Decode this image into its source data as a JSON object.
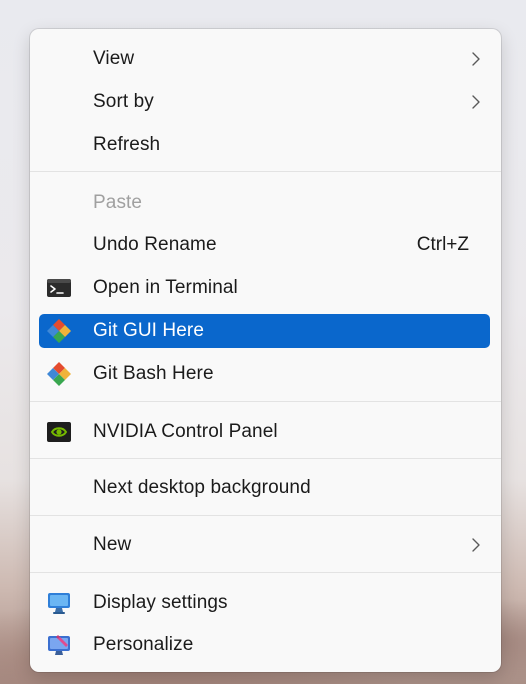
{
  "menu": {
    "items": {
      "view": {
        "label": "View",
        "has_submenu": true,
        "icon": ""
      },
      "sort_by": {
        "label": "Sort by",
        "has_submenu": true,
        "icon": ""
      },
      "refresh": {
        "label": "Refresh",
        "icon": ""
      },
      "paste": {
        "label": "Paste",
        "disabled": true,
        "icon": ""
      },
      "undo_rename": {
        "label": "Undo Rename",
        "shortcut": "Ctrl+Z",
        "icon": ""
      },
      "open_terminal": {
        "label": "Open in Terminal",
        "icon": "terminal-icon"
      },
      "git_gui": {
        "label": "Git GUI Here",
        "icon": "git-icon",
        "highlighted": true
      },
      "git_bash": {
        "label": "Git Bash Here",
        "icon": "git-icon"
      },
      "nvidia": {
        "label": "NVIDIA Control Panel",
        "icon": "nvidia-icon"
      },
      "next_bg": {
        "label": "Next desktop background",
        "icon": ""
      },
      "new": {
        "label": "New",
        "has_submenu": true,
        "icon": ""
      },
      "display": {
        "label": "Display settings",
        "icon": "monitor-icon"
      },
      "personalize": {
        "label": "Personalize",
        "icon": "personalize-icon"
      }
    }
  },
  "colors": {
    "highlight": "#0a67cc",
    "menu_background": "#f9f9f9",
    "disabled_text": "#a0a0a0",
    "text": "#1b1b1b"
  }
}
